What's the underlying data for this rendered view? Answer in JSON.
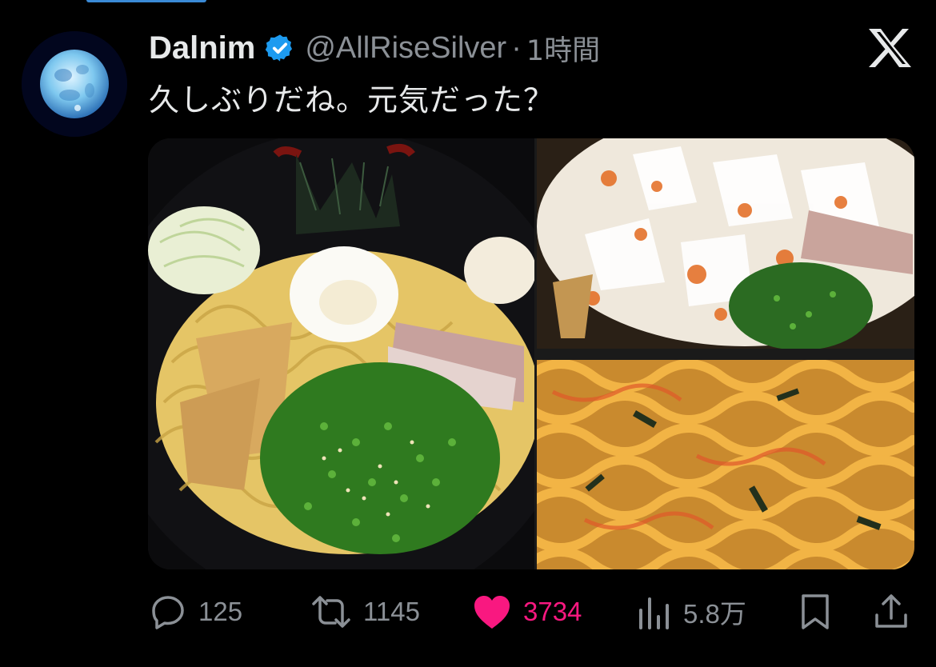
{
  "tweet": {
    "author_name": "Dalnim",
    "handle": "@AllRiseSilver",
    "separator": "·",
    "time": "1時間",
    "text": "久しぶりだね。元気だった？",
    "media_count": 3
  },
  "metrics": {
    "replies": "125",
    "reposts": "1145",
    "likes": "3734",
    "views": "5.8万"
  },
  "icons": {
    "avatar": "full-moon-avatar",
    "verified": "verified-badge-icon",
    "platform": "x-logo-icon",
    "reply": "reply-icon",
    "repost": "repost-icon",
    "like": "heart-icon",
    "views": "views-bar-chart-icon",
    "bookmark": "bookmark-icon",
    "share": "share-icon"
  },
  "colors": {
    "background": "#000000",
    "text_primary": "#e7e9ea",
    "text_secondary": "#8b9096",
    "verified_blue": "#1d9bf0",
    "like_pink": "#f91880"
  }
}
